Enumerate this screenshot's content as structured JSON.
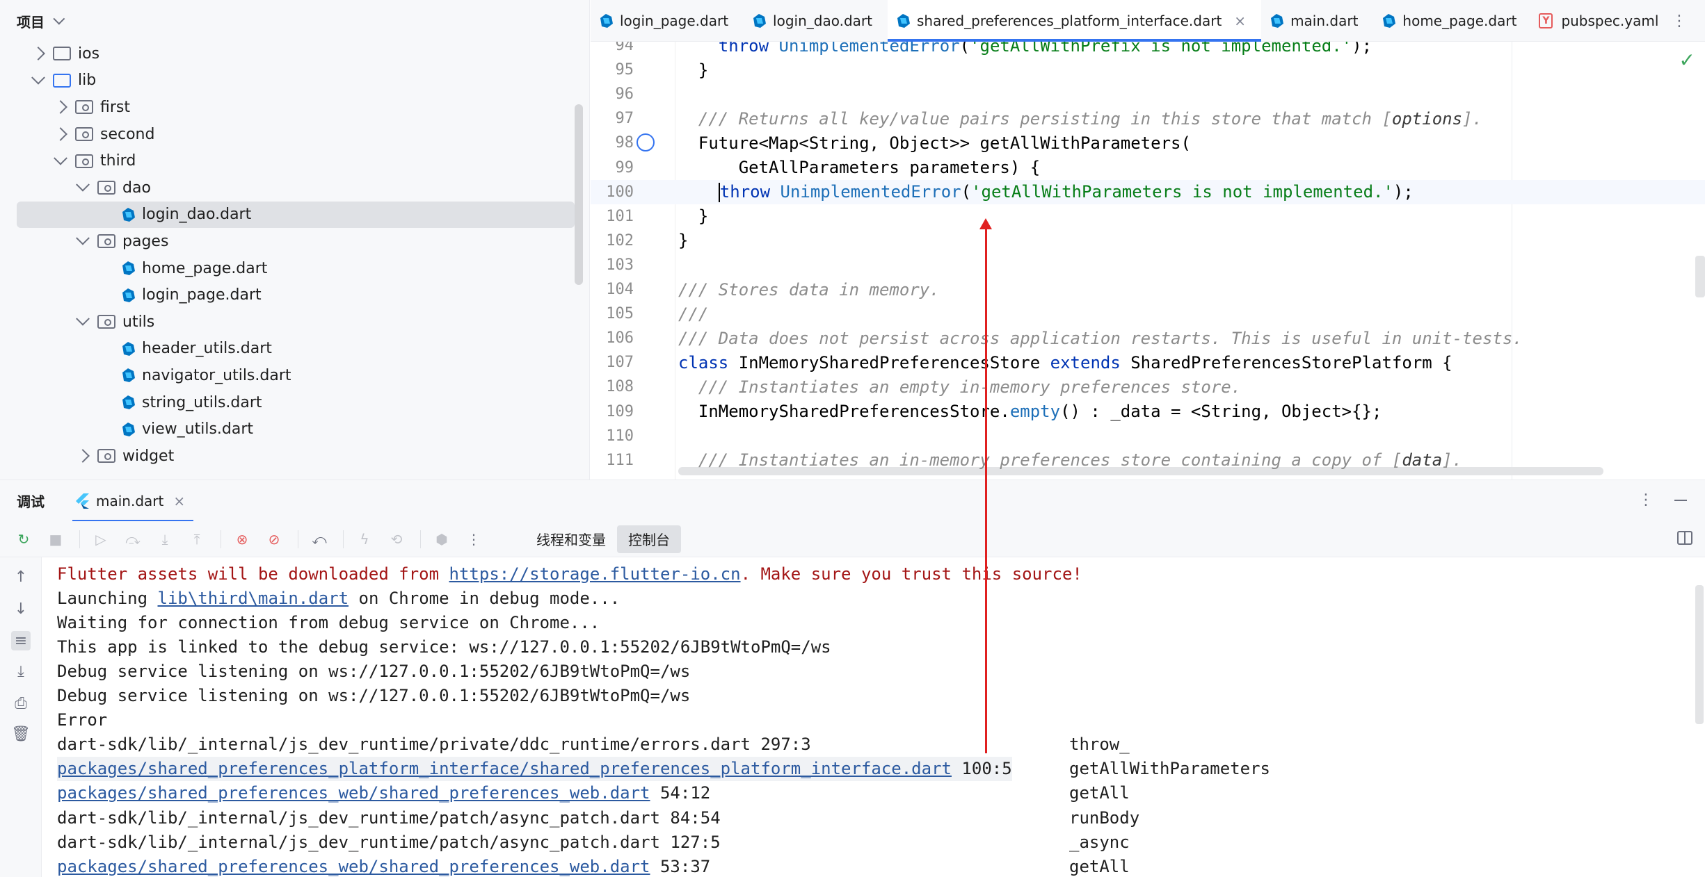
{
  "project": {
    "title": "项目",
    "tree": [
      {
        "label": "ios",
        "depth": 0,
        "arrow": "right",
        "kind": "folder"
      },
      {
        "label": "lib",
        "depth": 0,
        "arrow": "down",
        "kind": "folder-blue"
      },
      {
        "label": "first",
        "depth": 1,
        "arrow": "right",
        "kind": "package"
      },
      {
        "label": "second",
        "depth": 1,
        "arrow": "right",
        "kind": "package"
      },
      {
        "label": "third",
        "depth": 1,
        "arrow": "down",
        "kind": "package"
      },
      {
        "label": "dao",
        "depth": 2,
        "arrow": "down",
        "kind": "package"
      },
      {
        "label": "login_dao.dart",
        "depth": 3,
        "arrow": "none",
        "kind": "dart",
        "selected": true
      },
      {
        "label": "pages",
        "depth": 2,
        "arrow": "down",
        "kind": "package"
      },
      {
        "label": "home_page.dart",
        "depth": 3,
        "arrow": "none",
        "kind": "dart"
      },
      {
        "label": "login_page.dart",
        "depth": 3,
        "arrow": "none",
        "kind": "dart"
      },
      {
        "label": "utils",
        "depth": 2,
        "arrow": "down",
        "kind": "package"
      },
      {
        "label": "header_utils.dart",
        "depth": 3,
        "arrow": "none",
        "kind": "dart"
      },
      {
        "label": "navigator_utils.dart",
        "depth": 3,
        "arrow": "none",
        "kind": "dart"
      },
      {
        "label": "string_utils.dart",
        "depth": 3,
        "arrow": "none",
        "kind": "dart"
      },
      {
        "label": "view_utils.dart",
        "depth": 3,
        "arrow": "none",
        "kind": "dart"
      },
      {
        "label": "widget",
        "depth": 2,
        "arrow": "right",
        "kind": "package"
      }
    ]
  },
  "editor": {
    "tabs": [
      {
        "label": "login_page.dart",
        "icon": "dart-icon"
      },
      {
        "label": "login_dao.dart",
        "icon": "dart-icon"
      },
      {
        "label": "shared_preferences_platform_interface.dart",
        "icon": "dart-icon",
        "active": true,
        "close": "×"
      },
      {
        "label": "main.dart",
        "icon": "dart-icon"
      },
      {
        "label": "home_page.dart",
        "icon": "dart-icon"
      },
      {
        "label": "pubspec.yaml",
        "icon": "yaml-icon"
      }
    ],
    "more": "⋮",
    "check": "✓",
    "lines": [
      {
        "n": "94",
        "tokens": [
          [
            "",
            "    "
          ],
          [
            "kw",
            "throw "
          ],
          [
            "fn",
            "UnimplementedError"
          ],
          [
            "ty",
            "("
          ],
          [
            "str",
            "'getAllWithPrefix is not implemented.'"
          ],
          [
            "ty",
            ");"
          ]
        ]
      },
      {
        "n": "95",
        "tokens": [
          [
            "ty",
            "  }"
          ]
        ]
      },
      {
        "n": "96",
        "tokens": []
      },
      {
        "n": "97",
        "tokens": [
          [
            "cm",
            "  /// Returns all key/value pairs persisting in this store that match ["
          ],
          [
            "cmb",
            "options"
          ],
          [
            "cm",
            "]."
          ]
        ]
      },
      {
        "n": "98",
        "tokens": [
          [
            "ty",
            "  Future<Map<String, Object>> getAllWithParameters("
          ]
        ],
        "gutter": true
      },
      {
        "n": "99",
        "tokens": [
          [
            "ty",
            "      GetAllParameters parameters) {"
          ]
        ]
      },
      {
        "n": "100",
        "tokens": [
          [
            "",
            "    "
          ],
          [
            "caret",
            ""
          ],
          [
            "kw",
            "throw "
          ],
          [
            "fn",
            "UnimplementedError"
          ],
          [
            "ty",
            "("
          ],
          [
            "str",
            "'getAllWithParameters is not implemented.'"
          ],
          [
            "ty",
            ");"
          ]
        ],
        "current": true
      },
      {
        "n": "101",
        "tokens": [
          [
            "ty",
            "  }"
          ]
        ]
      },
      {
        "n": "102",
        "tokens": [
          [
            "ty",
            "}"
          ]
        ]
      },
      {
        "n": "103",
        "tokens": []
      },
      {
        "n": "104",
        "tokens": [
          [
            "cm",
            "/// Stores data in memory."
          ]
        ]
      },
      {
        "n": "105",
        "tokens": [
          [
            "cm",
            "///"
          ]
        ]
      },
      {
        "n": "106",
        "tokens": [
          [
            "cm",
            "/// Data does not persist across application restarts. This is useful in unit-tests."
          ]
        ]
      },
      {
        "n": "107",
        "tokens": [
          [
            "kw",
            "class "
          ],
          [
            "ty",
            "InMemorySharedPreferencesStore "
          ],
          [
            "kw",
            "extends "
          ],
          [
            "ty",
            "SharedPreferencesStorePlatform {"
          ]
        ]
      },
      {
        "n": "108",
        "tokens": [
          [
            "cm",
            "  /// Instantiates an empty in-memory preferences store."
          ]
        ]
      },
      {
        "n": "109",
        "tokens": [
          [
            "ty",
            "  InMemorySharedPreferencesStore."
          ],
          [
            "fn",
            "empty"
          ],
          [
            "ty",
            "() : _data = <String, Object>{};"
          ]
        ]
      },
      {
        "n": "110",
        "tokens": []
      },
      {
        "n": "111",
        "tokens": [
          [
            "cm",
            "  /// Instantiates an in-memory preferences store containing a copy of ["
          ],
          [
            "cmb",
            "data"
          ],
          [
            "cm",
            "]."
          ]
        ]
      }
    ]
  },
  "debug": {
    "title": "调试",
    "session_tab": "main.dart",
    "close": "×",
    "more": "⋮",
    "subtabs": [
      {
        "label": "线程和变量",
        "active": false
      },
      {
        "label": "控制台",
        "active": true
      }
    ],
    "toolbar_icons": [
      {
        "name": "rerun-icon",
        "glyph": "↻",
        "cls": "green"
      },
      {
        "name": "stop-icon",
        "glyph": "■",
        "cls": "faded"
      },
      {
        "sep": true
      },
      {
        "name": "resume-icon",
        "glyph": "▷",
        "cls": "faded"
      },
      {
        "name": "step-over-icon",
        "glyph": "⤼",
        "cls": "faded"
      },
      {
        "name": "step-into-icon",
        "glyph": "⤓",
        "cls": "faded"
      },
      {
        "name": "step-out-icon",
        "glyph": "⤒",
        "cls": "faded"
      },
      {
        "sep": true
      },
      {
        "name": "view-breakpoints-icon",
        "glyph": "⊗",
        "cls": "red"
      },
      {
        "name": "mute-breakpoints-icon",
        "glyph": "⊘",
        "cls": "red"
      },
      {
        "sep": true
      },
      {
        "name": "restore-layout-icon",
        "glyph": "⤺",
        "cls": ""
      },
      {
        "sep": true
      },
      {
        "name": "hot-reload-icon",
        "glyph": "ϟ",
        "cls": "faded"
      },
      {
        "name": "hot-restart-icon",
        "glyph": "⟲",
        "cls": "faded"
      },
      {
        "sep": true
      },
      {
        "name": "devtools-icon",
        "glyph": "⬢",
        "cls": "faded"
      },
      {
        "name": "more-icon",
        "glyph": "⋮",
        "cls": ""
      }
    ],
    "side_tools": [
      {
        "name": "scroll-up-icon",
        "glyph": "↑"
      },
      {
        "name": "scroll-down-icon",
        "glyph": "↓"
      },
      {
        "name": "soft-wrap-icon",
        "glyph": "≡",
        "active": true
      },
      {
        "name": "scroll-to-end-icon",
        "glyph": "⤓"
      },
      {
        "name": "print-icon",
        "glyph": "⎙"
      },
      {
        "name": "clear-all-icon",
        "glyph": "🗑"
      }
    ],
    "console": [
      {
        "parts": [
          [
            "",
            "Flutter assets will be downloaded from "
          ],
          [
            "lnk",
            "https://storage.flutter-io.cn"
          ],
          [
            "",
            ". Make sure you trust this source!"
          ]
        ],
        "warn": true
      },
      {
        "parts": [
          [
            "",
            "Launching "
          ],
          [
            "lnk",
            "lib\\third\\main.dart"
          ],
          [
            "",
            " on Chrome in debug mode..."
          ]
        ]
      },
      {
        "parts": [
          [
            "",
            "Waiting for connection from debug service on Chrome..."
          ]
        ]
      },
      {
        "parts": [
          [
            "",
            "This app is linked to the debug service: ws://127.0.0.1:55202/6JB9tWtoPmQ=/ws"
          ]
        ]
      },
      {
        "parts": [
          [
            "",
            "Debug service listening on ws://127.0.0.1:55202/6JB9tWtoPmQ=/ws"
          ]
        ]
      },
      {
        "parts": [
          [
            "",
            "Debug service listening on ws://127.0.0.1:55202/6JB9tWtoPmQ=/ws"
          ]
        ]
      },
      {
        "parts": [
          [
            "",
            "Error"
          ]
        ]
      },
      {
        "parts": [
          [
            "",
            "dart-sdk/lib/_internal/js_dev_runtime/private/ddc_runtime/errors.dart 297:3"
          ]
        ],
        "fn": "throw_"
      },
      {
        "parts": [
          [
            "lnk",
            "packages/shared_preferences_platform_interface/shared_preferences_platform_interface.dart"
          ],
          [
            "",
            " 100:5"
          ]
        ],
        "fn": "getAllWithParameters",
        "hl": true
      },
      {
        "parts": [
          [
            "lnk",
            "packages/shared_preferences_web/shared_preferences_web.dart"
          ],
          [
            "",
            " 54:12"
          ]
        ],
        "fn": "getAll"
      },
      {
        "parts": [
          [
            "",
            "dart-sdk/lib/_internal/js_dev_runtime/patch/async_patch.dart 84:54"
          ]
        ],
        "fn": "runBody"
      },
      {
        "parts": [
          [
            "",
            "dart-sdk/lib/_internal/js_dev_runtime/patch/async_patch.dart 127:5"
          ]
        ],
        "fn": "_async"
      },
      {
        "parts": [
          [
            "lnk",
            "packages/shared_preferences_web/shared_preferences_web.dart"
          ],
          [
            "",
            " 53:37"
          ]
        ],
        "fn": "getAll"
      }
    ]
  },
  "colors": {
    "accent": "#3574f0",
    "annotation": "#e02020",
    "warning_text": "#a31515",
    "link": "#2c5aa0"
  }
}
